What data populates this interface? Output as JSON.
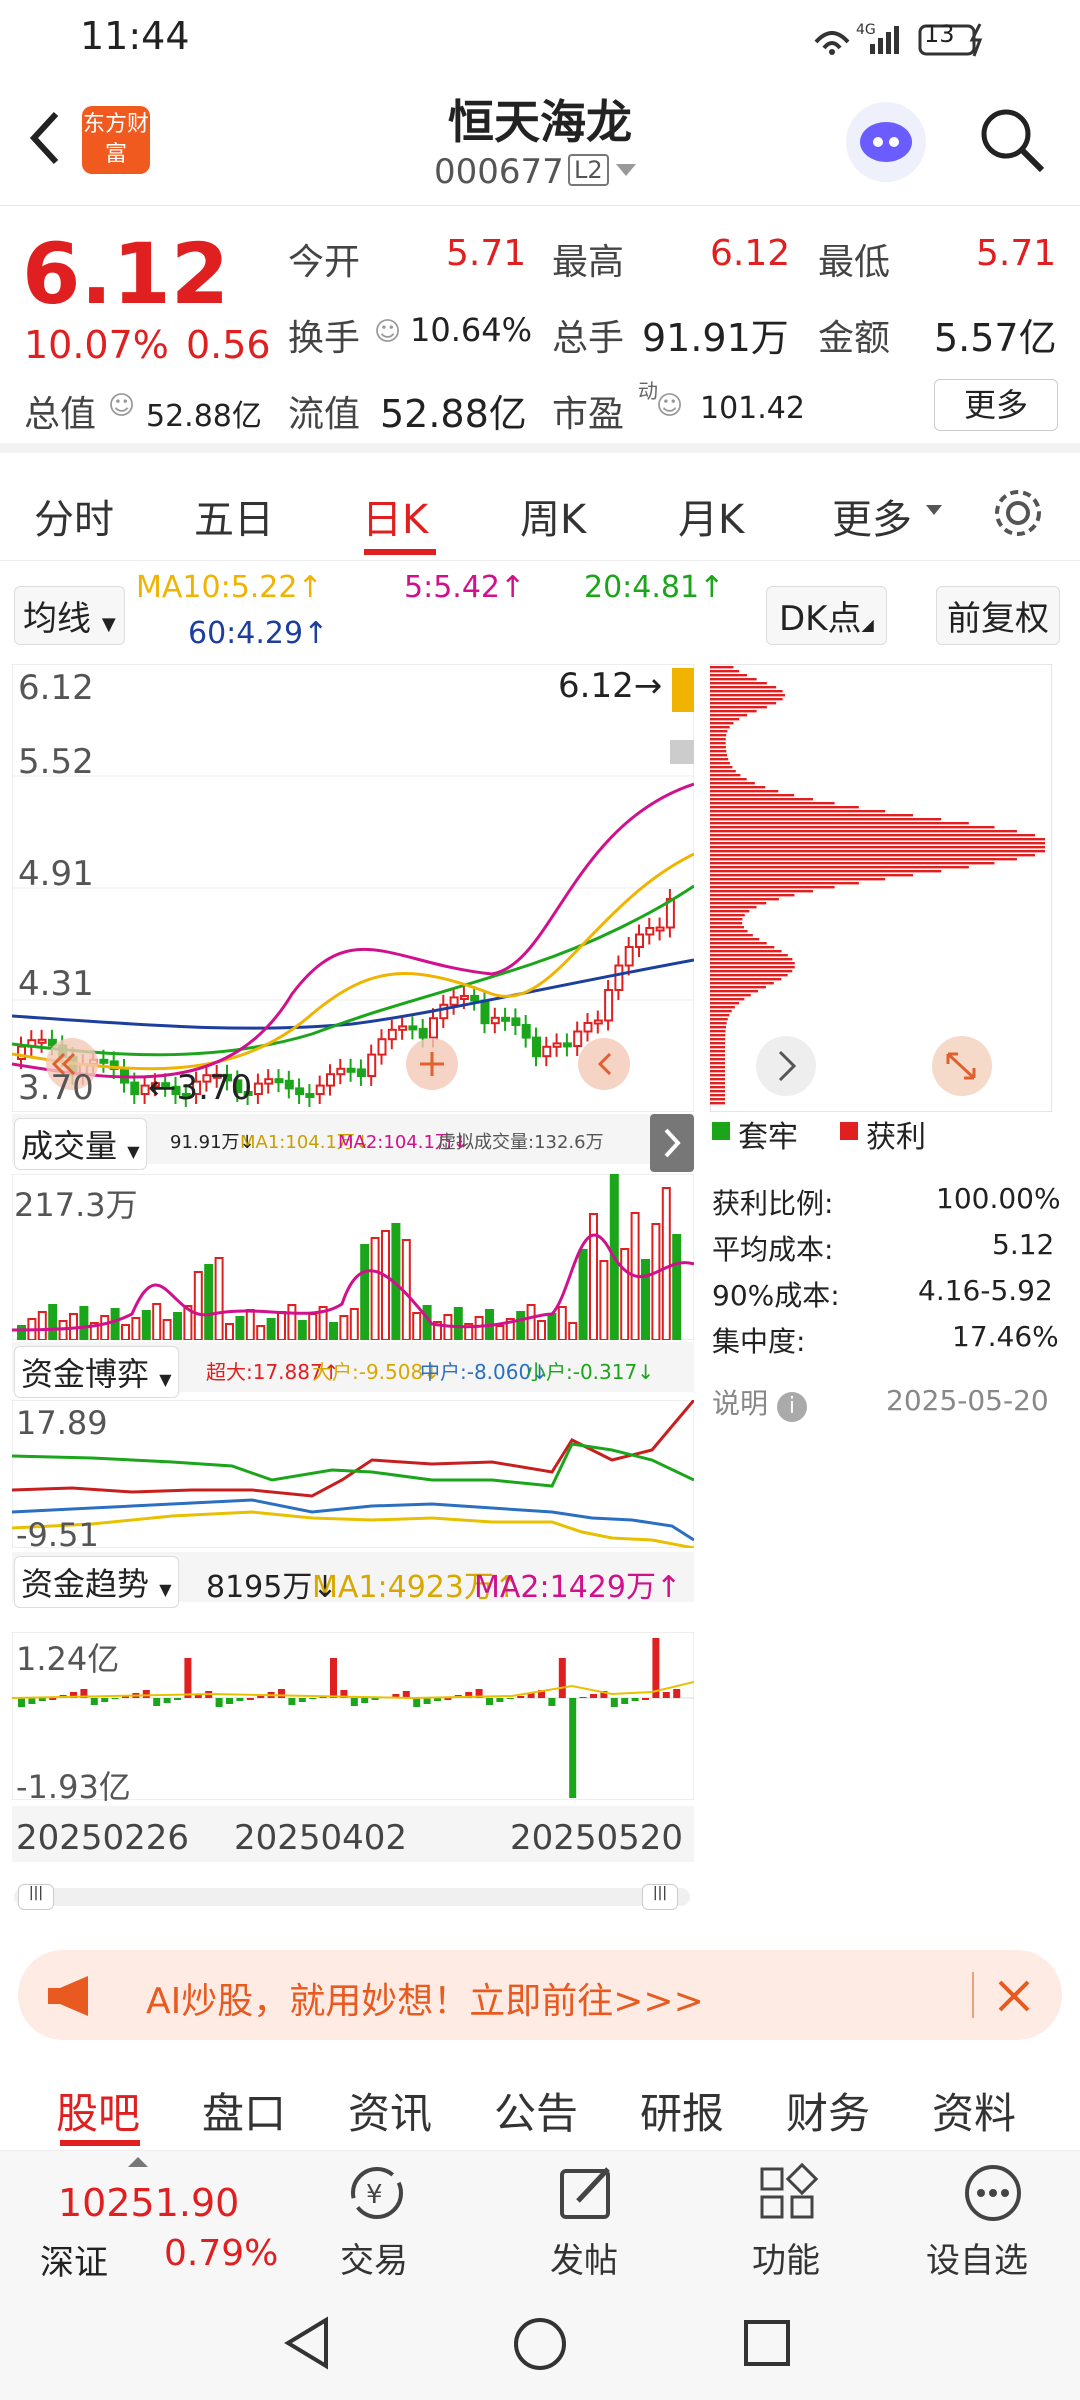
{
  "status": {
    "time": "11:44",
    "net": "4G",
    "battery": "13"
  },
  "header": {
    "back_icon": "chevron-left-icon",
    "logo_text": "东方财富",
    "title": "恒天海龙",
    "code": "000677",
    "level": "L2"
  },
  "quote": {
    "price": "6.12",
    "change_pct": "10.07%",
    "change": "0.56",
    "open_label": "今开",
    "open": "5.71",
    "high_label": "最高",
    "high": "6.12",
    "low_label": "最低",
    "low": "5.71",
    "turnover_label": "换手",
    "turnover": "10.64%",
    "volume_label": "总手",
    "volume": "91.91万",
    "amount_label": "金额",
    "amount": "5.57亿",
    "mktcap_label": "总值",
    "mktcap": "52.88亿",
    "float_label": "流值",
    "float": "52.88亿",
    "pe_label": "市盈",
    "pe_sup": "动",
    "pe": "101.42",
    "more": "更多"
  },
  "tabs": [
    "分时",
    "五日",
    "日K",
    "周K",
    "月K",
    "更多"
  ],
  "ma": {
    "select": "均线",
    "ma10": "MA10:5.22↑",
    "ma5": "5:5.42↑",
    "ma20": "20:4.81↑",
    "ma60": "60:4.29↑",
    "dk": "DK点",
    "fq": "前复权"
  },
  "kline": {
    "y_labels": [
      "6.12",
      "5.52",
      "4.91",
      "4.31",
      "3.70"
    ],
    "high_note": "6.12",
    "low_note": "3.70"
  },
  "volume": {
    "select": "成交量",
    "legend1": "91.91万↓",
    "legend2": "MA1:104.1万↓",
    "legend3": "MA2:104.1万↓",
    "legend4": "虚拟成交量:132.6万",
    "max_label": "217.3万"
  },
  "capital": {
    "select": "资金博弈",
    "l1": "超大:17.887↑",
    "l2": "大户:-9.508↓",
    "l3": "中户:-8.060↓",
    "l4": "小户:-0.317↓",
    "top": "17.89",
    "bottom": "-9.51"
  },
  "trend": {
    "select": "资金趋势",
    "l1": "8195万↓",
    "l2": "MA1:4923万↑",
    "l3": "MA2:1429万↑",
    "top": "1.24亿",
    "bottom": "-1.93亿"
  },
  "dates": [
    "20250226",
    "20250402",
    "20250520"
  ],
  "chip": {
    "legend1": "套牢",
    "legend2": "获利",
    "rows": [
      {
        "k": "获利比例:",
        "v": "100.00%"
      },
      {
        "k": "平均成本:",
        "v": "5.12"
      },
      {
        "k": "90%成本:",
        "v": "4.16-5.92"
      },
      {
        "k": "集中度:",
        "v": "17.46%"
      }
    ],
    "note": "说明",
    "date": "2025-05-20"
  },
  "banner": {
    "text": "AI炒股，就用妙想！立即前往>>>"
  },
  "subtabs": [
    "股吧",
    "盘口",
    "资讯",
    "公告",
    "研报",
    "财务",
    "资料"
  ],
  "bottom": {
    "index_value": "10251.90",
    "index_name": "深证",
    "index_pct": "0.79%",
    "items": [
      "交易",
      "发帖",
      "功能",
      "设自选"
    ]
  },
  "colors": {
    "up": "#e02020",
    "down": "#1aa51a",
    "ma5": "#d0108c",
    "ma10": "#f0b400",
    "ma20": "#1aa51a",
    "ma60": "#1c3f9e"
  }
}
